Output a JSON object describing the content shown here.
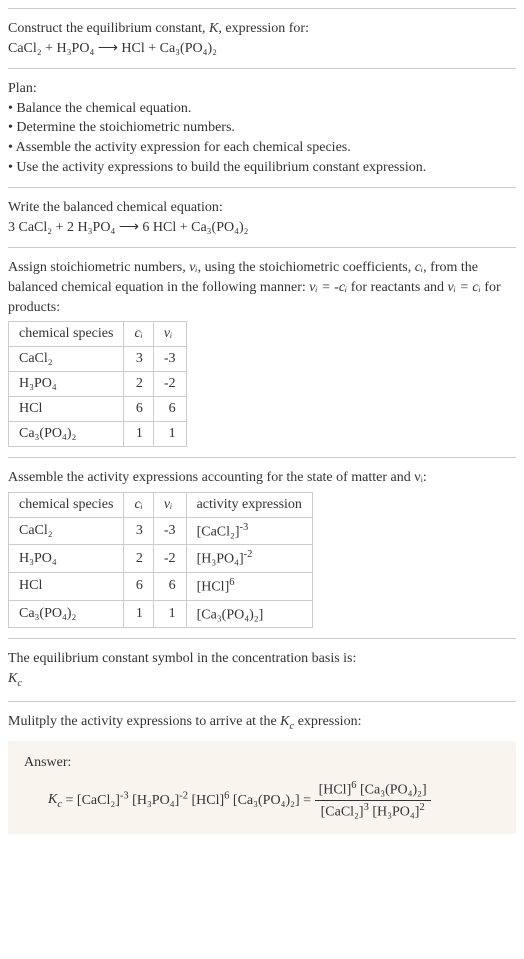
{
  "header": {
    "title_line1": "Construct the equilibrium constant, ",
    "title_K": "K",
    "title_line1_end": ", expression for:",
    "equation": "CaCl₂ + H₃PO₄ ⟶ HCl + Ca₃(PO₄)₂"
  },
  "plan": {
    "heading": "Plan:",
    "items": [
      "• Balance the chemical equation.",
      "• Determine the stoichiometric numbers.",
      "• Assemble the activity expression for each chemical species.",
      "• Use the activity expressions to build the equilibrium constant expression."
    ]
  },
  "balanced": {
    "heading": "Write the balanced chemical equation:",
    "equation": "3 CaCl₂ + 2 H₃PO₄ ⟶ 6 HCl + Ca₃(PO₄)₂"
  },
  "stoich": {
    "text1": "Assign stoichiometric numbers, ",
    "nu_i": "νᵢ",
    "text2": ", using the stoichiometric coefficients, ",
    "c_i": "cᵢ",
    "text3": ", from the balanced chemical equation in the following manner: ",
    "eq1": "νᵢ = -cᵢ",
    "text4": " for reactants and ",
    "eq2": "νᵢ = cᵢ",
    "text5": " for products:",
    "table": {
      "headers": [
        "chemical species",
        "cᵢ",
        "νᵢ"
      ],
      "rows": [
        [
          "CaCl₂",
          "3",
          "-3"
        ],
        [
          "H₃PO₄",
          "2",
          "-2"
        ],
        [
          "HCl",
          "6",
          "6"
        ],
        [
          "Ca₃(PO₄)₂",
          "1",
          "1"
        ]
      ]
    }
  },
  "activity": {
    "heading": "Assemble the activity expressions accounting for the state of matter and νᵢ:",
    "table": {
      "headers": [
        "chemical species",
        "cᵢ",
        "νᵢ",
        "activity expression"
      ],
      "rows": [
        {
          "species": "CaCl₂",
          "c": "3",
          "nu": "-3",
          "expr_base": "[CaCl₂]",
          "expr_exp": "-3"
        },
        {
          "species": "H₃PO₄",
          "c": "2",
          "nu": "-2",
          "expr_base": "[H₃PO₄]",
          "expr_exp": "-2"
        },
        {
          "species": "HCl",
          "c": "6",
          "nu": "6",
          "expr_base": "[HCl]",
          "expr_exp": "6"
        },
        {
          "species": "Ca₃(PO₄)₂",
          "c": "1",
          "nu": "1",
          "expr_base": "[Ca₃(PO₄)₂]",
          "expr_exp": ""
        }
      ]
    }
  },
  "eqconst": {
    "text": "The equilibrium constant symbol in the concentration basis is:",
    "symbol": "K",
    "symbol_sub": "c"
  },
  "multiply": {
    "text": "Mulitply the activity expressions to arrive at the ",
    "Kc": "K",
    "Kc_sub": "c",
    "text_end": " expression:"
  },
  "answer": {
    "label": "Answer:",
    "Kc": "K",
    "Kc_sub": "c",
    "eq": " = [CaCl₂]",
    "exp1": "-3",
    "t2": " [H₃PO₄]",
    "exp2": "-2",
    "t3": " [HCl]",
    "exp3": "6",
    "t4": " [Ca₃(PO₄)₂] = ",
    "frac_num1": "[HCl]",
    "frac_num1_exp": "6",
    "frac_num2": " [Ca₃(PO₄)₂]",
    "frac_den1": "[CaCl₂]",
    "frac_den1_exp": "3",
    "frac_den2": " [H₃PO₄]",
    "frac_den2_exp": "2"
  }
}
